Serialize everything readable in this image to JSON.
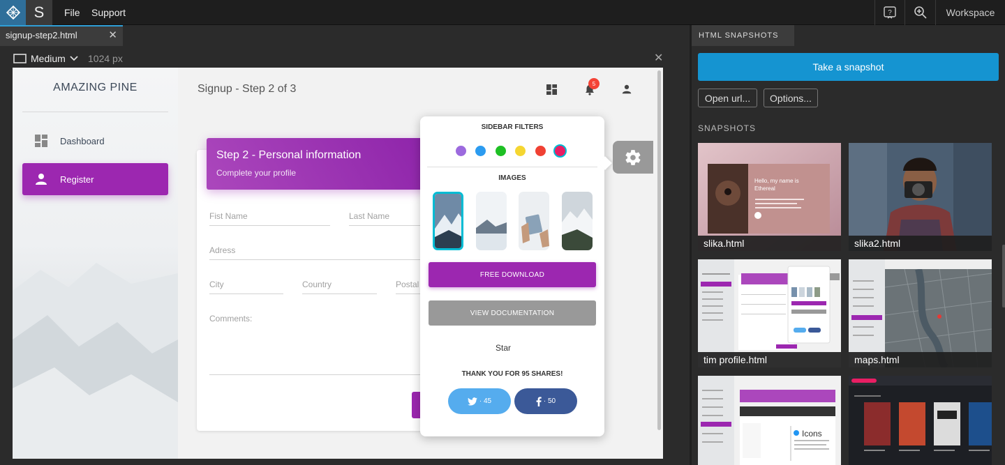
{
  "menu": {
    "file": "File",
    "support": "Support",
    "workspace": "Workspace",
    "s_label": "S"
  },
  "tab": {
    "title": "signup-step2.html"
  },
  "viewport": {
    "size_label": "Medium",
    "width_label": "1024 px"
  },
  "site": {
    "brand": "AMAZING PINE",
    "nav": [
      {
        "label": "Dashboard"
      },
      {
        "label": "Register"
      }
    ],
    "page_title": "Signup - Step 2 of 3",
    "notification_count": "5",
    "card": {
      "title": "Step 2 - Personal information",
      "subtitle": "Complete your profile",
      "fields": {
        "first_name": "Fist Name",
        "last_name": "Last Name",
        "address": "Adress",
        "city": "City",
        "country": "Country",
        "postal": "Postal",
        "comments": "Comments:"
      }
    },
    "plugin": {
      "sidebar_filters": "SIDEBAR FILTERS",
      "images": "IMAGES",
      "free_download": "FREE DOWNLOAD",
      "view_docs": "VIEW DOCUMENTATION",
      "star": "Star",
      "thanks": "THANK YOU FOR 95 SHARES!",
      "twitter_count": "· 45",
      "facebook_count": "· 50",
      "colors": [
        "#9c6ade",
        "#2b9bf0",
        "#1ec024",
        "#f5d631",
        "#f04133",
        "#e91e63"
      ]
    }
  },
  "right_panel": {
    "tab": "HTML SNAPSHOTS",
    "take_snapshot": "Take a snapshot",
    "open_url": "Open url...",
    "options": "Options...",
    "snapshots_label": "SNAPSHOTS",
    "snapshots": [
      {
        "name": "slika.html",
        "headline": "Hello, my name is Ethereal"
      },
      {
        "name": "slika2.html"
      },
      {
        "name": "tim profile.html"
      },
      {
        "name": "maps.html"
      },
      {
        "name": "",
        "preview_text": "Icons"
      },
      {
        "name": ""
      }
    ]
  }
}
